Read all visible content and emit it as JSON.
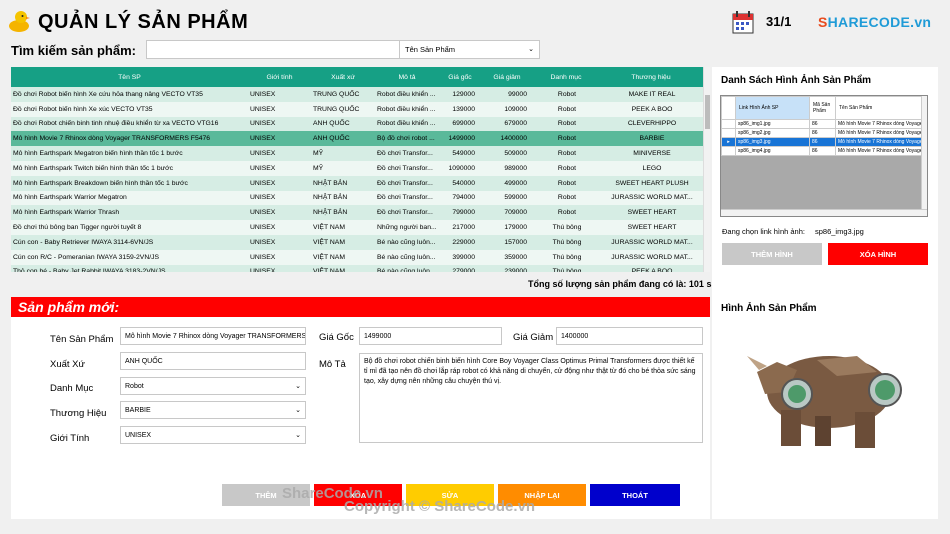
{
  "header": {
    "title": "QUẢN LÝ SẢN PHẨM",
    "date": "31/1",
    "brand": {
      "prefix": "S",
      "rest": "HARECODE.vn"
    }
  },
  "search": {
    "label": "Tìm kiếm sản phẩm:",
    "value": "",
    "field_selected": "Tên Sản Phẩm"
  },
  "products": {
    "columns": [
      "Tên SP",
      "Giới tính",
      "Xuất xứ",
      "Mô tả",
      "Giá gốc",
      "Giá giảm",
      "Danh mục",
      "Thương hiệu"
    ],
    "rows": [
      [
        "Đồ chơi Robot biến hình Xe cứu hỏa thang nâng VECTO VT35",
        "UNISEX",
        "TRUNG QUỐC",
        "Robot điều khiển ...",
        "129000",
        "99000",
        "Robot",
        "MAKE IT REAL"
      ],
      [
        "Đồ chơi Robot biến hình Xe xúc VECTO VT35",
        "UNISEX",
        "TRUNG QUỐC",
        "Robot điều khiển ...",
        "139000",
        "109000",
        "Robot",
        "PEEK A BOO"
      ],
      [
        "Đồ chơi Robot chiến binh tinh nhuệ điều khiển từ xa VECTO VTG16",
        "UNISEX",
        "ANH QUỐC",
        "Robot điều khiển ...",
        "699000",
        "679000",
        "Robot",
        "CLEVERHIPPO"
      ],
      [
        "Mô hình Movie 7 Rhinox dòng Voyager TRANSFORMERS F5476",
        "UNISEX",
        "ANH QUỐC",
        "Bộ đồ chơi robot ...",
        "1499000",
        "1400000",
        "Robot",
        "BARBIE"
      ],
      [
        "Mô hình Earthspark Megatron biến hình thần tốc 1 bước",
        "UNISEX",
        "MỸ",
        "Đồ chơi Transfor...",
        "549000",
        "509000",
        "Robot",
        "MINIVERSE"
      ],
      [
        "Mô hình Earthspark Twitch biến hình thần tốc 1 bước",
        "UNISEX",
        "MỸ",
        "Đồ chơi Transfor...",
        "1090000",
        "989000",
        "Robot",
        "LEGO"
      ],
      [
        "Mô hình Earthspark Breakdown biến hình thần tốc 1 bước",
        "UNISEX",
        "NHẬT BẢN",
        "Đồ chơi Transfor...",
        "540000",
        "499000",
        "Robot",
        "SWEET HEART PLUSH"
      ],
      [
        "Mô hình Earthspark Warrior Megatron",
        "UNISEX",
        "NHẬT BẢN",
        "Đồ chơi Transfor...",
        "794000",
        "599000",
        "Robot",
        "JURASSIC WORLD MAT..."
      ],
      [
        "Mô hình Earthspark Warrior Thrash",
        "UNISEX",
        "NHẬT BẢN",
        "Đồ chơi Transfor...",
        "799000",
        "709000",
        "Robot",
        "SWEET HEART"
      ],
      [
        "Đồ chơi thú bông ban Tigger người tuyết 8",
        "UNISEX",
        "VIỆT NAM",
        "Những người ban...",
        "217000",
        "179000",
        "Thú bông",
        "SWEET HEART"
      ],
      [
        "Cún con - Baby Retriever IWAYA 3114-6VN/JS",
        "UNISEX",
        "VIỆT NAM",
        "Bé nào cũng luôn...",
        "229000",
        "157000",
        "Thú bông",
        "JURASSIC WORLD MAT..."
      ],
      [
        "Cún con R/C - Pomeranian IWAYA 3159-2VN/JS",
        "UNISEX",
        "VIỆT NAM",
        "Bé nào cũng luôn...",
        "399000",
        "359000",
        "Thú bông",
        "JURASSIC WORLD MAT..."
      ],
      [
        "Thỏ con bé - Baby Jet Rabbit IWAYA 3183-2VN/JS",
        "UNISEX",
        "VIỆT NAM",
        "Bé nào cũng luôn...",
        "279000",
        "239000",
        "Thú bông",
        "PEEK A BOO"
      ]
    ]
  },
  "total_text": "Tổng số lượng sản phẩm đang có là: 101 sp",
  "form": {
    "heading": "Sản phẩm mới:",
    "name_label": "Tên Sản Phẩm",
    "name_value": "Mô hình Movie 7 Rhinox dòng Voyager TRANSFORMERS F5476",
    "origin_label": "Xuất Xứ",
    "origin_value": "ANH QUỐC",
    "category_label": "Danh Mục",
    "category_value": "Robot",
    "brand_label": "Thương Hiệu",
    "brand_value": "BARBIE",
    "gender_label": "Giới Tính",
    "gender_value": "UNISEX",
    "price_label": "Giá Gốc",
    "price_value": "1499000",
    "discount_label": "Giá Giảm",
    "discount_value": "1400000",
    "desc_label": "Mô Tả",
    "desc_value": "Bộ đồ chơi robot chiến binh biến hình Core Boy Voyager Class Optimus Primal Transformers được thiết kế tỉ mỉ đã tạo nên đồ chơi lắp ráp robot có khả năng di chuyển, cử động như thật từ đó cho bé thỏa sức sáng tạo, xây dựng nên những câu chuyện thú vị."
  },
  "buttons": {
    "add": "THÊM",
    "delete": "XÓA",
    "edit": "SỬA",
    "reset": "NHẬP LẠI",
    "exit": "THOÁT"
  },
  "images": {
    "title": "Danh Sách Hình Ảnh Sản Phẩm",
    "columns": [
      "Link Hình Ảnh SP",
      "Mã Sản Phẩm",
      "Tên Sản Phẩm"
    ],
    "rows": [
      [
        "sp86_img1.jpg",
        "86",
        "Mô hình Movie 7 Rhinox dòng Voyager TRANSFORMERS F5476"
      ],
      [
        "sp86_img2.jpg",
        "86",
        "Mô hình Movie 7 Rhinox dòng Voyager TRANSFORMERS F5476"
      ],
      [
        "sp86_img3.jpg",
        "86",
        "Mô hình Movie 7 Rhinox dòng Voyager TRANSFORMERS F5476"
      ],
      [
        "sp86_img4.jpg",
        "86",
        "Mô hình Movie 7 Rhinox dòng Voyager TRANSFORMERS F5476"
      ]
    ],
    "selected_label": "Đang chọn link hình ảnh:",
    "selected_value": "sp86_img3.jpg",
    "add_button": "THÊM HÌNH",
    "delete_button": "XÓA HÌNH",
    "preview_title": "Hình Ảnh Sản Phẩm"
  },
  "watermark": {
    "mid": "ShareCode.vn",
    "copyright": "Copyright © ShareCode.vn"
  },
  "colors": {
    "header_teal": "#16a085",
    "row_selected": "#5ab99a",
    "red": "#ff0000",
    "yellow": "#ffcc00",
    "orange": "#ff8c00",
    "blue": "#0000cc",
    "disabled_gray": "#c8c8c8"
  }
}
